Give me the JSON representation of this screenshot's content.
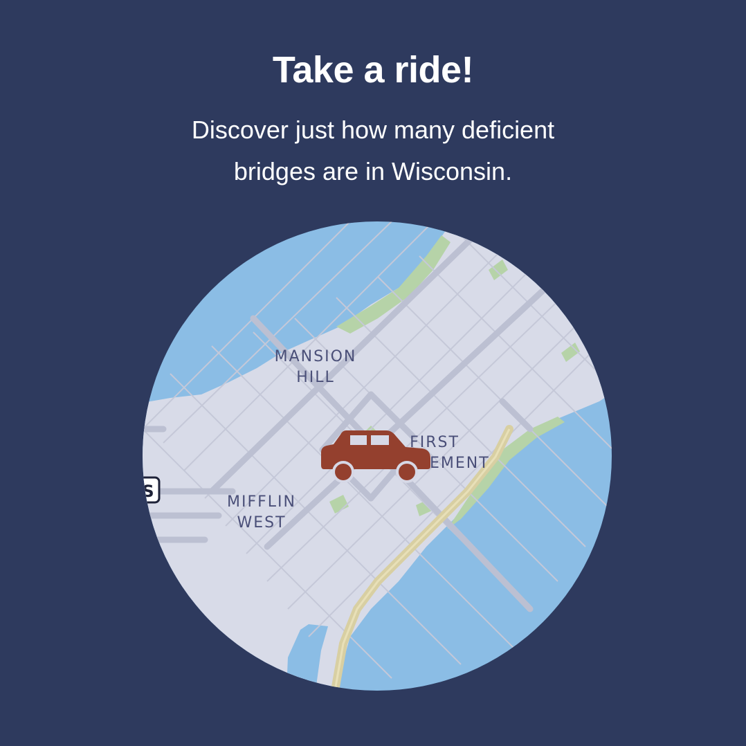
{
  "header": {
    "title": "Take a ride!",
    "subtitle": "Discover just how many deficient bridges are in Wisconsin."
  },
  "map": {
    "neighborhoods": [
      {
        "id": "mansion-hill",
        "line1": "MANSION",
        "line2": "HILL"
      },
      {
        "id": "first-settlement",
        "line1": "FIRST",
        "line2": "SETTLEMENT"
      },
      {
        "id": "mifflin-west",
        "line1": "MIFFLIN",
        "line2": "WEST"
      }
    ],
    "route_shield_text": "S",
    "colors": {
      "water": "#8bbde5",
      "land": "#d8dbe8",
      "park": "#b6d3a8",
      "road": "#bfc2d2",
      "highway": "#dcd3ac",
      "label": "#4a4f78"
    }
  },
  "marker": {
    "icon": "car-icon",
    "color": "#94402e"
  },
  "theme": {
    "background": "#2e3a5e",
    "text": "#ffffff"
  }
}
